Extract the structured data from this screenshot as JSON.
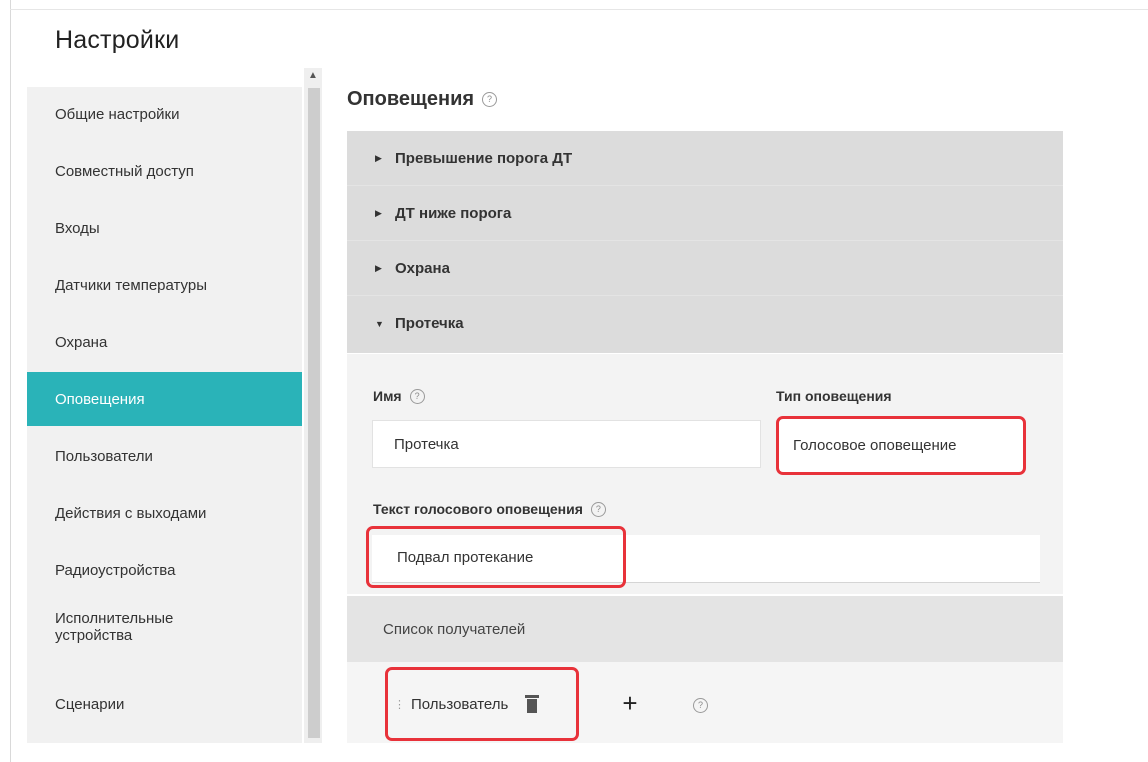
{
  "page": {
    "title": "Настройки"
  },
  "sidebar": {
    "items": [
      {
        "label": "Общие настройки",
        "active": false
      },
      {
        "label": "Совместный доступ",
        "active": false
      },
      {
        "label": "Входы",
        "active": false
      },
      {
        "label": "Датчики температуры",
        "active": false
      },
      {
        "label": "Охрана",
        "active": false
      },
      {
        "label": "Оповещения",
        "active": true
      },
      {
        "label": "Пользователи",
        "active": false
      },
      {
        "label": "Действия с выходами",
        "active": false
      },
      {
        "label": "Радиоустройства",
        "active": false
      },
      {
        "label": "Исполнительные устройства",
        "active": false
      },
      {
        "label": "Сценарии",
        "active": false
      }
    ]
  },
  "main": {
    "section_title": "Оповещения",
    "accordion": [
      {
        "label": "Превышение порога ДТ",
        "expanded": false
      },
      {
        "label": "ДТ ниже порога",
        "expanded": false
      },
      {
        "label": "Охрана",
        "expanded": false
      },
      {
        "label": "Протечка",
        "expanded": true
      }
    ],
    "form": {
      "name_label": "Имя",
      "name_value": "Протечка",
      "type_label": "Тип оповещения",
      "type_value": "Голосовое оповещение",
      "voice_text_label": "Текст голосового оповещения",
      "voice_text_value": "Подвал протекание",
      "recipients_label": "Список получателей",
      "recipient_chip": "Пользователь",
      "add_symbol": "+"
    }
  },
  "colors": {
    "accent": "#2ab3b8",
    "highlight": "#e8323a",
    "sidebar_bg": "#f1f1f1",
    "accordion_bg": "#dcdcdc"
  },
  "icons": {
    "help": "help-circle-icon",
    "collapsed": "triangle-right-icon",
    "expanded": "triangle-down-icon",
    "delete": "trash-icon",
    "drag": "drag-handle-icon"
  }
}
